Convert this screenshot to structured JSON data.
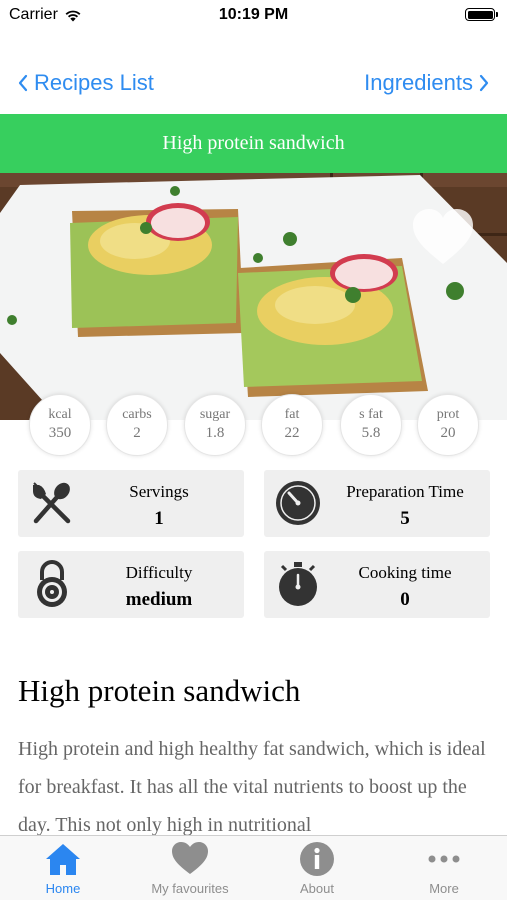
{
  "status": {
    "carrier": "Carrier",
    "time": "10:19 PM"
  },
  "nav": {
    "back_label": "Recipes List",
    "forward_label": "Ingredients"
  },
  "title": "High protein sandwich",
  "nutrition": [
    {
      "label": "kcal",
      "value": "350"
    },
    {
      "label": "carbs",
      "value": "2"
    },
    {
      "label": "sugar",
      "value": "1.8"
    },
    {
      "label": "fat",
      "value": "22"
    },
    {
      "label": "s fat",
      "value": "5.8"
    },
    {
      "label": "prot",
      "value": "20"
    }
  ],
  "cards": {
    "servings": {
      "label": "Servings",
      "value": "1"
    },
    "prep": {
      "label": "Preparation Time",
      "value": "5"
    },
    "difficulty": {
      "label": "Difficulty",
      "value": "medium"
    },
    "cooking": {
      "label": "Cooking time",
      "value": "0"
    }
  },
  "recipe": {
    "heading": "High protein sandwich",
    "description": "High protein and high healthy fat sandwich, which is ideal for breakfast. It has all the vital nutrients to boost up the day. This not only high in nutritional"
  },
  "tabs": [
    {
      "label": "Home",
      "icon": "home-icon",
      "active": true
    },
    {
      "label": "My favourites",
      "icon": "heart-icon",
      "active": false
    },
    {
      "label": "About",
      "icon": "info-icon",
      "active": false
    },
    {
      "label": "More",
      "icon": "more-icon",
      "active": false
    }
  ],
  "colors": {
    "accent": "#2f8cf0",
    "title_bar": "#37cf5e",
    "card_bg": "#efefef",
    "tab_active": "#2b86f0",
    "tab_inactive": "#8e8e8e"
  }
}
